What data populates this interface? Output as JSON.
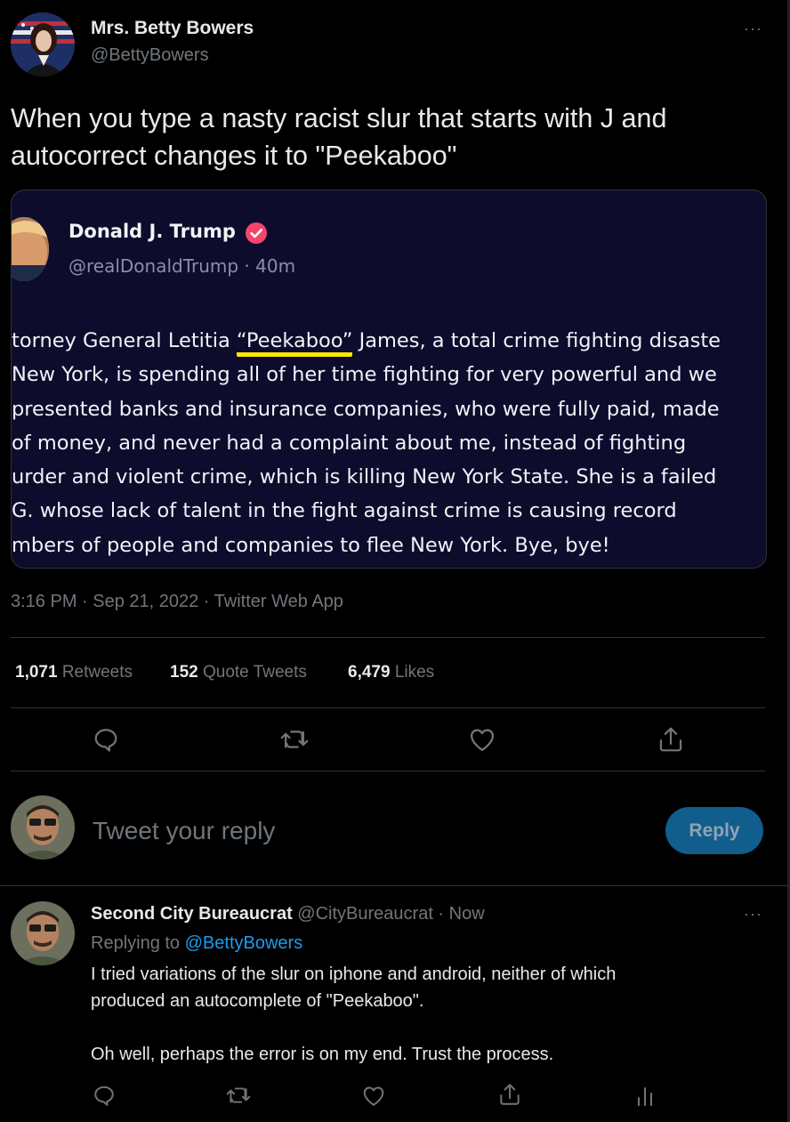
{
  "tweet": {
    "author_name": "Mrs. Betty Bowers",
    "author_handle": "@BettyBowers",
    "text_line1": "When you type a nasty racist slur that starts with J and",
    "text_line2": "autocorrect changes it to \"Peekaboo\"",
    "timestamp": "3:16 PM · Sep 21, 2022 · Twitter Web App",
    "stats": {
      "retweets_count": "1,071",
      "retweets_label": "Retweets",
      "quotes_count": "152",
      "quotes_label": "Quote Tweets",
      "likes_count": "6,479",
      "likes_label": "Likes"
    },
    "more_label": "···"
  },
  "embedded": {
    "author_name": "Donald J. Trump",
    "author_handle_time": "@realDonaldTrump · 40m",
    "lines": [
      {
        "pre": "torney General Letitia ",
        "highlight": "“Peekaboo”",
        "post": " James, a total crime fighting disaste"
      },
      {
        "pre": " New York, is spending all of her time fighting for very powerful and we",
        "highlight": "",
        "post": ""
      },
      {
        "pre": "presented banks and insurance companies, who were fully paid, made",
        "highlight": "",
        "post": ""
      },
      {
        "pre": " of money, and never had a complaint about me, instead of fighting",
        "highlight": "",
        "post": ""
      },
      {
        "pre": "urder and violent crime, which is killing New York State. She is a failed",
        "highlight": "",
        "post": ""
      },
      {
        "pre": "G. whose lack of talent in the fight against crime is causing record",
        "highlight": "",
        "post": ""
      },
      {
        "pre": "mbers of people and companies to flee New York. Bye, bye!",
        "highlight": "",
        "post": ""
      }
    ],
    "highlight_color": "#ffe600",
    "verified_color": "#f2476a"
  },
  "reply_box": {
    "placeholder": "Tweet your reply",
    "button_label": "Reply"
  },
  "reply": {
    "author_name": "Second City Bureaucrat",
    "author_handle_time": "@CityBureaucrat · Now",
    "replying_prefix": "Replying to ",
    "replying_handle": "@BettyBowers",
    "text_line1": "I tried variations of the slur on iphone and android, neither of which",
    "text_line2": "produced an autocomplete of \"Peekaboo\".",
    "text_line3": "Oh well, perhaps the error is on my end. Trust the process.",
    "more_label": "···"
  },
  "colors": {
    "accent": "#1d9bf0",
    "muted": "#71767b",
    "divider": "#2f3336",
    "background": "#000000"
  }
}
